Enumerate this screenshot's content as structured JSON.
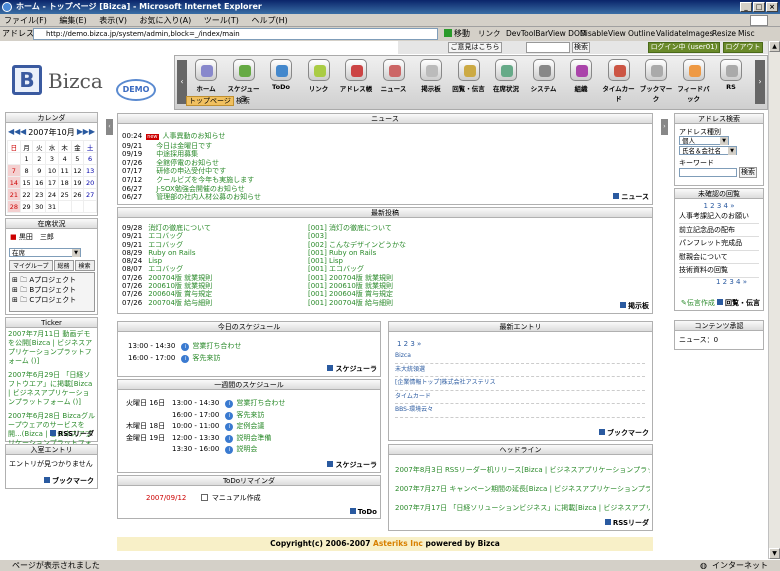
{
  "window": {
    "title": "ホーム - トップページ [Bizca] - Microsoft Internet Explorer"
  },
  "menu": [
    "ファイル(F)",
    "編集(E)",
    "表示(V)",
    "お気に入り(A)",
    "ツール(T)",
    "ヘルプ(H)"
  ],
  "address": {
    "label": "アドレス(D)",
    "url": "http://demo.bizca.jp/system/admin,block=_/index/main",
    "go": "移動",
    "links": "リンク"
  },
  "toolbar_links": [
    "DevToolBar",
    "View DOM",
    "Disable",
    "View",
    "Outline",
    "Validate",
    "Images",
    "Resize",
    "Misc"
  ],
  "status": {
    "text": "ページが表示されました",
    "zone": "インターネット"
  },
  "header": {
    "welcome_button": "ご意見はこちら",
    "search_button": "検索",
    "login_button": "ログイン中 (user01)",
    "logout_button": "ログアウト",
    "logo_text": "Bizca",
    "logo_badge": "DEMO"
  },
  "nav": [
    "ホーム",
    "スケジューラ",
    "ToDo",
    "リンク",
    "アドレス帳",
    "ニュース",
    "掲示板",
    "回覧・伝言",
    "在席状況",
    "システム",
    "組織",
    "タイムカード",
    "ブックマーク",
    "フィードバック",
    "RS"
  ],
  "subnav": [
    "トップページ",
    "検索"
  ],
  "calendar": {
    "title": "カレンダ",
    "month": "2007年10月",
    "weekdays": [
      "日",
      "月",
      "火",
      "水",
      "木",
      "金",
      "土"
    ],
    "weeks": [
      [
        "",
        "1",
        "2",
        "3",
        "4",
        "5",
        "6"
      ],
      [
        "7",
        "8",
        "9",
        "10",
        "11",
        "12",
        "13"
      ],
      [
        "14",
        "15",
        "16",
        "17",
        "18",
        "19",
        "20"
      ],
      [
        "21",
        "22",
        "23",
        "24",
        "25",
        "26",
        "27"
      ],
      [
        "28",
        "29",
        "30",
        "31",
        "",
        "",
        ""
      ]
    ]
  },
  "presence": {
    "title": "在席状況",
    "user": "黒田　三郎",
    "status": "在席",
    "tabs": [
      "マイグループ",
      "総務",
      "検索"
    ],
    "projects": [
      "Aプロジェクト",
      "Bプロジェクト",
      "Cプロジェクト"
    ]
  },
  "ticker": {
    "title": "Ticker",
    "items": [
      "2007年7月11日 動画デモを公開[Bizca | ビジネスアプリケーションプラットフォーム ()]",
      "2007年6月29日 「日経ソフトウエア」に掲載[Bizca | ビジネスアプリケーションプラットフォーム ()]",
      "2007年6月28日 Bizcaグループウェアのサービスを開...(Bizca | ビジネスアプリケーションプラットフォーム ()]"
    ],
    "more": "RSSリーダ"
  },
  "visitors": {
    "title": "入室エントリ",
    "text": "エントリが見つかりません",
    "more": "ブックマーク"
  },
  "news": {
    "title": "ニュース",
    "more": "ニュース",
    "items": [
      [
        "00:24",
        "人事異動のお知らせ"
      ],
      [
        "09/21",
        "今日は金曜日です"
      ],
      [
        "09/19",
        "中途採用募集"
      ],
      [
        "07/26",
        "全館停電のお知らせ"
      ],
      [
        "07/17",
        "研修の申込受付中です"
      ],
      [
        "07/12",
        "クールビズを今年も実施します"
      ],
      [
        "06/27",
        "J-SOX勉強会開催のお知らせ"
      ],
      [
        "06/27",
        "管理部の社内人材公募のお知らせ"
      ]
    ]
  },
  "board": {
    "title": "最新投稿",
    "more": "掲示板",
    "left": [
      [
        "09/28",
        "消灯の徹底について"
      ],
      [
        "09/21",
        "エコバッグ"
      ],
      [
        "09/21",
        "エコバッグ"
      ],
      [
        "08/29",
        "Ruby on Rails"
      ],
      [
        "08/24",
        "Lisp"
      ],
      [
        "08/07",
        "エコバッグ"
      ],
      [
        "07/26",
        "200704版 就業規則"
      ],
      [
        "07/26",
        "200610版 就業規則"
      ],
      [
        "07/26",
        "200604版 賞与規定"
      ],
      [
        "07/26",
        "200704版 給与細則"
      ]
    ],
    "right": [
      "[001] 消灯の徹底について",
      "[003]",
      "[002] こんなデザインどうかな",
      "[001] Ruby on Rails",
      "[001] Lisp",
      "[001] エコバッグ",
      "[001] 200704版 就業規則",
      "[001] 200610版 就業規則",
      "[001] 200604版 賞与規定",
      "[001] 200704版 給与細則"
    ]
  },
  "today": {
    "title": "今日のスケジュール",
    "more": "スケジューラ",
    "items": [
      [
        "13:00 - 14:30",
        "営業打ち合わせ"
      ],
      [
        "16:00 - 17:00",
        "客先来訪"
      ]
    ]
  },
  "week": {
    "title": "一週間のスケジュール",
    "more": "スケジューラ",
    "items": [
      [
        "火曜日 16日",
        "13:00 - 14:30",
        "営業打ち合わせ"
      ],
      [
        "",
        "16:00 - 17:00",
        "客先来訪"
      ],
      [
        "木曜日 18日",
        "10:00 - 11:00",
        "定例会議"
      ],
      [
        "金曜日 19日",
        "12:00 - 13:30",
        "説明会準備"
      ],
      [
        "",
        "13:30 - 16:00",
        "説明会"
      ]
    ]
  },
  "todo": {
    "title": "ToDoリマインダ",
    "date": "2007/09/12",
    "item": "マニュアル作成",
    "more": "ToDo"
  },
  "entries": {
    "title": "最新エントリ",
    "pager": "1 2 3 »",
    "items": [
      "Bizca",
      "未大統領選",
      "[企業情報トップ]株式会社アステリス",
      "タイムカード",
      "BBS-環境云々"
    ],
    "more": "ブックマーク"
  },
  "headlines": {
    "title": "ヘッドライン",
    "items": [
      "2007年8月3日 RSSリーダー机リリース[Bizca | ビジネスアプリケーションプラットフォーム ...",
      "2007年7月27日 キャンペーン期間の延長[Bizca | ビジネスアプリケーションプラットフ...",
      "2007年7月17日 「日経ソリューションビジネス」に掲載[Bizca | ビジネスアプリケーションプラットフォーム ()]"
    ],
    "more": "RSSリーダ"
  },
  "address_search": {
    "title": "アドレス検索",
    "kind_label": "アドレス種別",
    "kind": "個人",
    "field": "氏名＆会社名",
    "keyword_label": "キーワード",
    "button": "検索"
  },
  "circular": {
    "title": "未確認の回覧",
    "pager": "1 2 3 4 »",
    "items": [
      "人事考課記入のお願い",
      "前立記念品の配布",
      "パンフレット完成品",
      "慰親会について",
      "技術資料の回覧"
    ],
    "pager2": "1 2 3 4 »",
    "send": "伝言作成",
    "more": "回覧・伝言"
  },
  "contents": {
    "title": "コンテンツ承認",
    "text": "ニュース：0"
  },
  "footer": {
    "pre": "Copyright(c) 2006-2007 ",
    "company": "Asteriks Inc",
    "post": " powered by Bizca"
  }
}
